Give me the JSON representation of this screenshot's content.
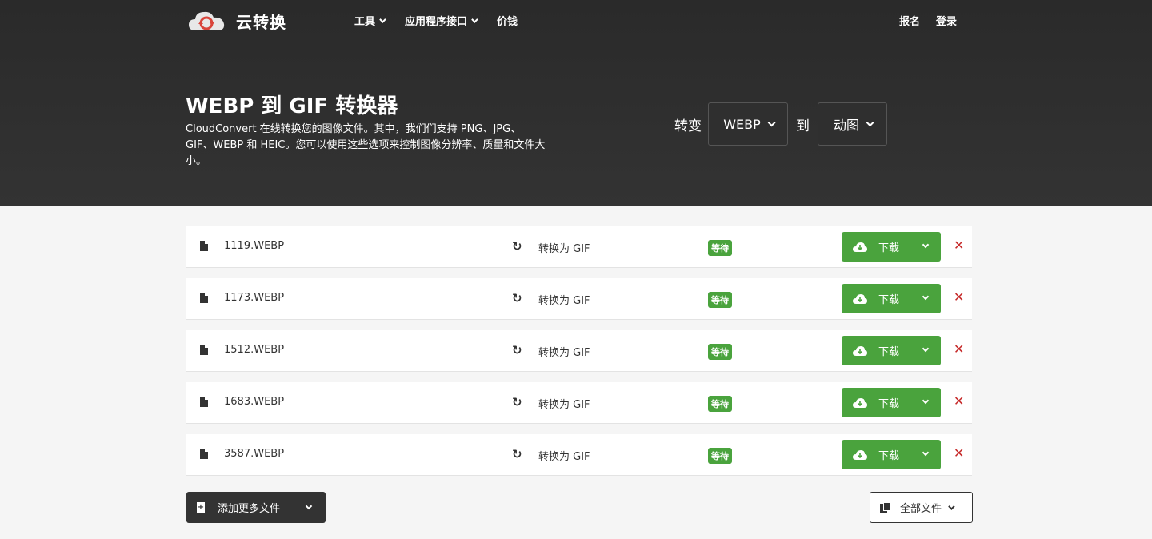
{
  "brand": {
    "name": "云转换"
  },
  "nav": {
    "left": [
      {
        "label": "工具",
        "dropdown": true
      },
      {
        "label": "应用程序接口",
        "dropdown": true
      },
      {
        "label": "价钱",
        "dropdown": false
      }
    ],
    "right": [
      {
        "label": "报名"
      },
      {
        "label": "登录"
      }
    ]
  },
  "hero": {
    "title": "WEBP 到 GIF 转换器",
    "description": "CloudConvert 在线转换您的图像文件。其中，我们们支持 PNG、JPG、GIF、WEBP 和 HEIC。您可以使用这些选项来控制图像分辨率、质量和文件大小。",
    "convert_label": "转变",
    "from_format": "WEBP",
    "to_label": "到",
    "to_format": "动图"
  },
  "files": [
    {
      "name": "1119.WEBP",
      "convert_text": "转换为 GIF",
      "status": "等待",
      "download_label": "下载"
    },
    {
      "name": "1173.WEBP",
      "convert_text": "转换为 GIF",
      "status": "等待",
      "download_label": "下载"
    },
    {
      "name": "1512.WEBP",
      "convert_text": "转换为 GIF",
      "status": "等待",
      "download_label": "下载"
    },
    {
      "name": "1683.WEBP",
      "convert_text": "转换为 GIF",
      "status": "等待",
      "download_label": "下载"
    },
    {
      "name": "3587.WEBP",
      "convert_text": "转换为 GIF",
      "status": "等待",
      "download_label": "下载"
    }
  ],
  "actions": {
    "add_more_label": "添加更多文件",
    "all_files_label": "全部文件"
  },
  "colors": {
    "hero_bg": "#2f2f2f",
    "accent_green": "#4aa33d",
    "delete_red": "#c62a2a"
  }
}
